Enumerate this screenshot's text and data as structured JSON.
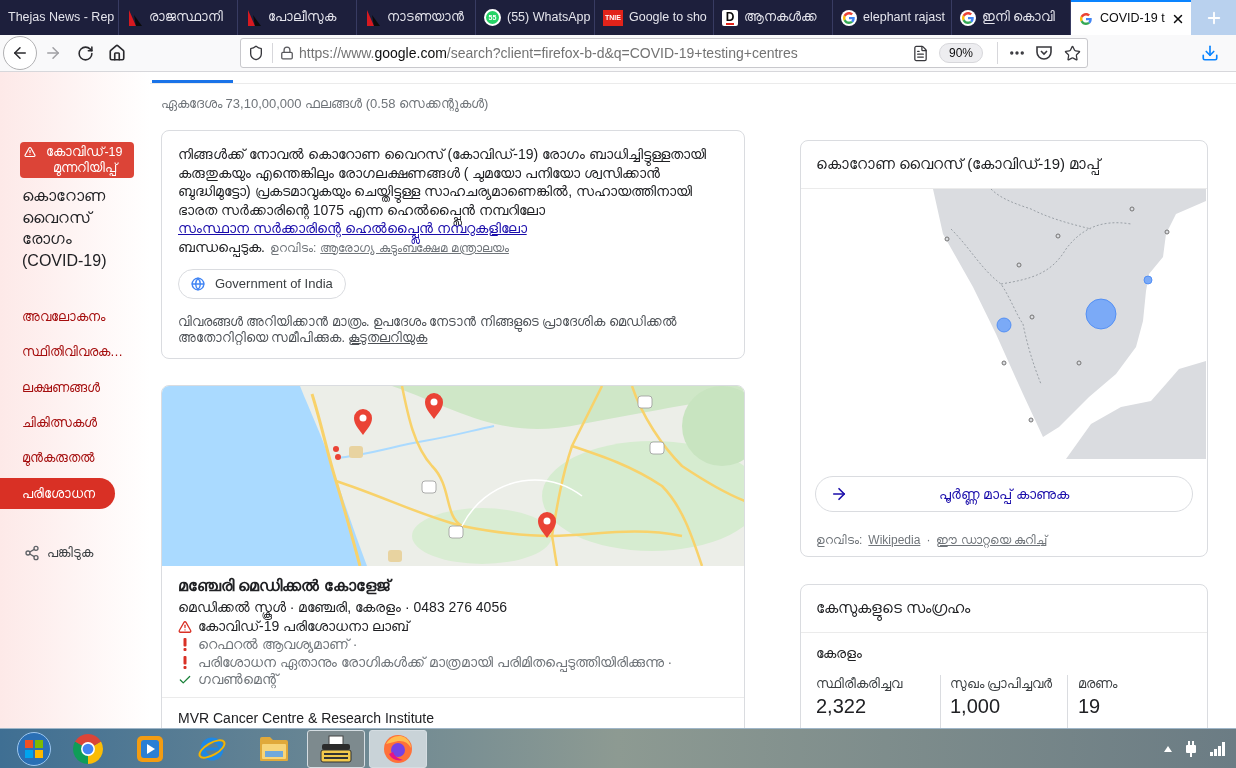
{
  "browser": {
    "tabs": [
      {
        "title": "Thejas News - Rep",
        "selected": false
      },
      {
        "title": "രാജസ്ഥാനി",
        "icon": {
          "kind": "sail"
        },
        "selected": false
      },
      {
        "title": "പോലീസുക",
        "icon": {
          "kind": "sail"
        },
        "selected": false
      },
      {
        "title": "നാടണയാൻ",
        "icon": {
          "kind": "sail"
        },
        "selected": false
      },
      {
        "title": "(55) WhatsApp",
        "icon": {
          "kind": "chat",
          "text": "55"
        },
        "selected": false
      },
      {
        "title": "Google to sho",
        "icon": {
          "kind": "tile",
          "text": "TNIE"
        },
        "selected": false
      },
      {
        "title": "ആനകൾക്ക",
        "icon": {
          "kind": "letter",
          "text": "D"
        },
        "selected": false
      },
      {
        "title": "elephant rajast",
        "icon": {
          "kind": "g"
        },
        "selected": false
      },
      {
        "title": "ഇനി കൊവി",
        "icon": {
          "kind": "g"
        },
        "selected": false
      },
      {
        "title": "COVID-19 t",
        "icon": {
          "kind": "g"
        },
        "selected": true
      }
    ],
    "address": {
      "scheme": "https://www.",
      "domain": "google.com",
      "path": "/search?client=firefox-b-d&q=COVID-19+testing+centres"
    },
    "zoom": "90%"
  },
  "sidebar": {
    "alert": "കോവിഡ്-19 മുന്നറിയിപ്പ്",
    "title": "കൊറോണ വൈറസ് രോഗം (COVID-19)",
    "nav": [
      {
        "label": "അവലോകനം",
        "selected": false
      },
      {
        "label": "സ്ഥിതിവിവരക…",
        "selected": false
      },
      {
        "label": "ലക്ഷണങ്ങൾ",
        "selected": false
      },
      {
        "label": "ചികിത്സകൾ",
        "selected": false
      },
      {
        "label": "മുൻകരുതൽ",
        "selected": false
      },
      {
        "label": "പരിശോധന",
        "selected": true
      }
    ],
    "share": "പങ്കിടുക"
  },
  "results": {
    "stats": "ഏകദേശം 73,10,00,000 ഫലങ്ങൾ (0.58 സെക്കന്റുകൾ)",
    "advisory": {
      "text_before": "നിങ്ങൾക്ക് നോവൽ കൊറോണ വൈറസ് (കോവിഡ്-19) രോഗം ബാധിച്ചിട്ടുള്ളതായി കരുതുകയും എന്തെങ്കിലും രോഗലക്ഷണങ്ങൾ ( ചുമയോ പനിയോ ശ്വസിക്കാൻ ബുദ്ധിമുട്ടോ) പ്രകടമാവുകയും ചെയ്തിട്ടുള്ള സാഹചര്യമാണെങ്കിൽ, സഹായത്തിനായി ഭാരത സർക്കാരിന്റെ 1075 എന്ന ഹെൽപ്പ്ലൈൻ നമ്പറിലോ",
      "link": "സംസ്ഥാന സർക്കാരിന്റെ ഹെൽപ്പ്ലൈൻ നമ്പറുകളിലോ",
      "text_after": "ബന്ധപ്പെടുക.",
      "source_label": "ഉറവിടം:",
      "source_link": "ആരോഗ്യ കുടുംബക്ഷേമ മന്ത്രാലയം",
      "chip": "Government of India",
      "disclaimer": "വിവരങ്ങൾ അറിയിക്കാൻ മാത്രം. ഉപദേശം നേടാൻ നിങ്ങളുടെ പ്രാദേശിക മെഡിക്കൽ അതോറിറ്റിയെ സമീപിക്കുക.",
      "more_link": "കൂടുതലറിയുക"
    },
    "places": [
      {
        "name": "മഞ്ചേരി മെഡിക്കൽ കോളേജ്",
        "details": "മെഡിക്കൽ സ്കൂൾ · മഞ്ചേരി, കേരളം · 0483 276 4056",
        "notes": [
          {
            "kind": "lab",
            "text": "കോവിഡ്-19 പരിശോധനാ ലാബ്"
          },
          {
            "kind": "alert",
            "text": "റെഫറൽ ആവശ്യമാണ് ·"
          },
          {
            "kind": "alert",
            "text": "പരിശോധന ഏതാനും രോഗികൾക്ക് മാത്രമായി പരിമിതപ്പെടുത്തിയിരിക്കുന്നു ·"
          },
          {
            "kind": "check",
            "text": "ഗവൺമെന്റ്"
          }
        ]
      },
      {
        "name": "MVR Cancer Centre & Research Institute"
      }
    ]
  },
  "map_card": {
    "title": "കൊറോണ വൈറസ് (കോവിഡ്-19) മാപ്പ്",
    "button": "പൂർണ്ണ മാപ്പ് കാണുക",
    "source": [
      {
        "kind": "label",
        "text": "ഉറവിടം:"
      },
      {
        "kind": "link",
        "text": "Wikipedia"
      },
      {
        "kind": "separator",
        "text": "·"
      },
      {
        "kind": "link",
        "text": "ഈ ഡാറ്റയെ കുറിച്ച്"
      }
    ]
  },
  "cases_card": {
    "title": "കേസുകളുടെ സംഗ്രഹം",
    "region": "കേരളം",
    "stats": [
      {
        "label": "സ്ഥിരീകരിച്ചവ",
        "value": "2,322"
      },
      {
        "label": "സുഖം പ്രാപിച്ചവർ",
        "value": "1,000"
      },
      {
        "label": "മരണം",
        "value": "19"
      }
    ]
  },
  "taskbar": {
    "apps": [
      {
        "kind": "chrome",
        "open": false,
        "selected": false
      },
      {
        "kind": "media",
        "open": false,
        "selected": false
      },
      {
        "kind": "ie",
        "open": false,
        "selected": false
      },
      {
        "kind": "folder",
        "open": false,
        "selected": false
      },
      {
        "kind": "typewriter",
        "open": true,
        "selected": false
      },
      {
        "kind": "firefox",
        "open": true,
        "selected": true
      }
    ]
  }
}
